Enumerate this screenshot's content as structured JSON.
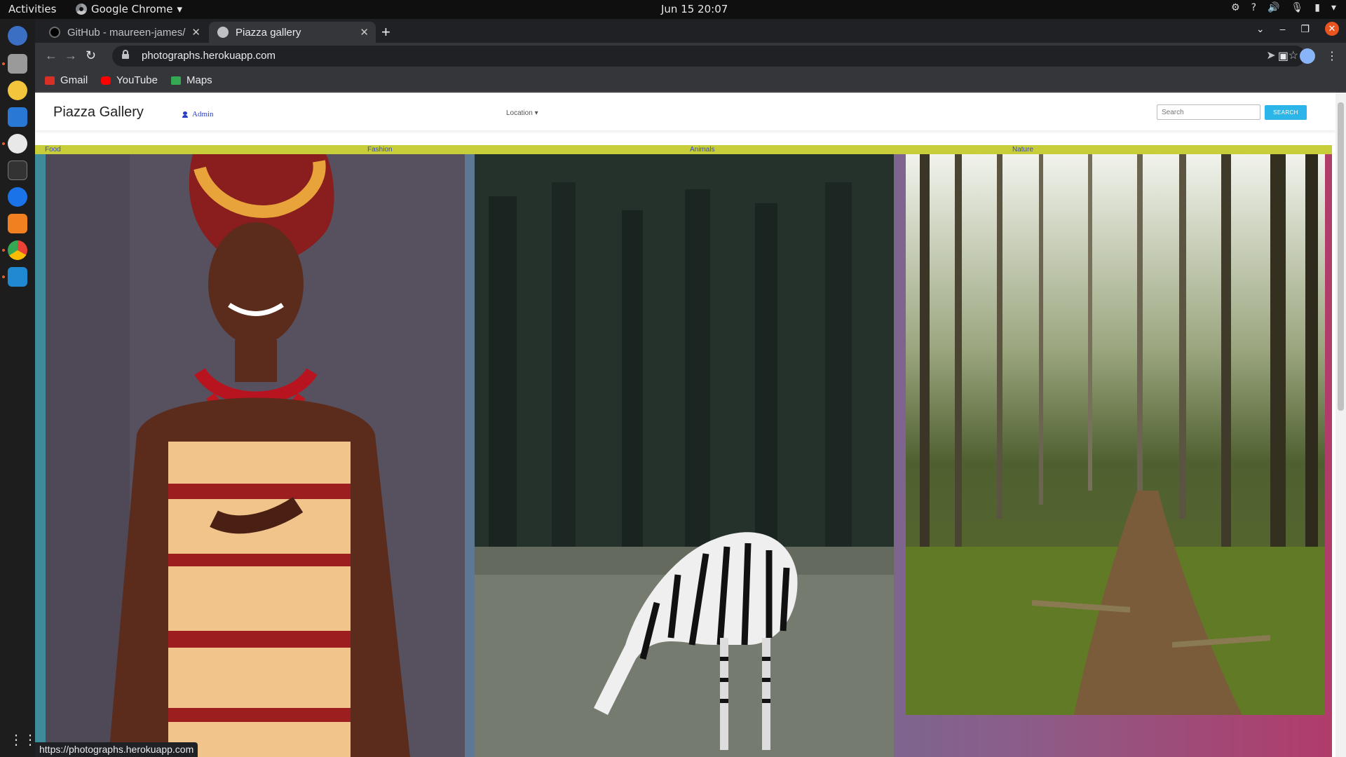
{
  "system": {
    "activities": "Activities",
    "app_name": "Google Chrome",
    "clock": "Jun 15  20:07"
  },
  "browser": {
    "tabs": [
      {
        "label": "GitHub - maureen-james/",
        "active": false
      },
      {
        "label": "Piazza gallery",
        "active": true
      }
    ],
    "url": "photographs.herokuapp.com",
    "bookmarks": [
      {
        "label": "Gmail",
        "icon": "gmail-icon",
        "color": "#d93025"
      },
      {
        "label": "YouTube",
        "icon": "youtube-icon",
        "color": "#ff0000"
      },
      {
        "label": "Maps",
        "icon": "maps-icon",
        "color": "#34a853"
      }
    ],
    "status_url": "https://photographs.herokuapp.com"
  },
  "page": {
    "brand": "Piazza Gallery",
    "admin_link": "Admin",
    "location_dropdown": "Location",
    "search_placeholder": "Search",
    "search_button": "SEARCH",
    "categories": [
      "Food",
      "Fashion",
      "Animals",
      "Nature"
    ],
    "colors": {
      "category_bar": "#c8cd3a",
      "search_button": "#2bb5e8",
      "link": "#2a3dc8"
    },
    "photos": [
      {
        "subject": "woman in African print dress and headwrap",
        "icon": "portrait-photo"
      },
      {
        "subject": "zebra grazing in forest clearing",
        "icon": "zebra-photo"
      },
      {
        "subject": "forest path with tall trees",
        "icon": "forest-photo"
      }
    ]
  }
}
